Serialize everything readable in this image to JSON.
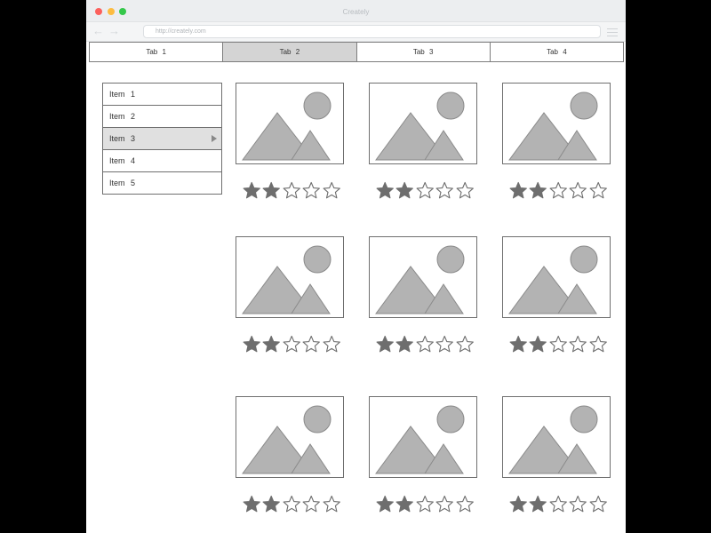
{
  "window": {
    "title": "Creately",
    "url": "http://creately.com"
  },
  "tabs": [
    {
      "label": "Tab 1",
      "active": false
    },
    {
      "label": "Tab 2",
      "active": true
    },
    {
      "label": "Tab 3",
      "active": false
    },
    {
      "label": "Tab 4",
      "active": false
    }
  ],
  "sidebar": {
    "items": [
      {
        "label": "Item 1",
        "selected": false
      },
      {
        "label": "Item 2",
        "selected": false
      },
      {
        "label": "Item 3",
        "selected": true
      },
      {
        "label": "Item 4",
        "selected": false
      },
      {
        "label": "Item 5",
        "selected": false
      }
    ]
  },
  "gallery": {
    "cards": [
      {
        "image": "image-placeholder-icon",
        "rating": 2,
        "max_rating": 5
      },
      {
        "image": "image-placeholder-icon",
        "rating": 2,
        "max_rating": 5
      },
      {
        "image": "image-placeholder-icon",
        "rating": 2,
        "max_rating": 5
      },
      {
        "image": "image-placeholder-icon",
        "rating": 2,
        "max_rating": 5
      },
      {
        "image": "image-placeholder-icon",
        "rating": 2,
        "max_rating": 5
      },
      {
        "image": "image-placeholder-icon",
        "rating": 2,
        "max_rating": 5
      },
      {
        "image": "image-placeholder-icon",
        "rating": 2,
        "max_rating": 5
      },
      {
        "image": "image-placeholder-icon",
        "rating": 2,
        "max_rating": 5
      },
      {
        "image": "image-placeholder-icon",
        "rating": 2,
        "max_rating": 5
      }
    ]
  },
  "colors": {
    "star_filled": "#6e6e6e",
    "star_empty": "#ffffff",
    "star_stroke": "#6e6e6e",
    "placeholder_fill": "#b3b3b3",
    "active_tab": "#d4d4d4",
    "selected_item": "#e0e0e0"
  }
}
